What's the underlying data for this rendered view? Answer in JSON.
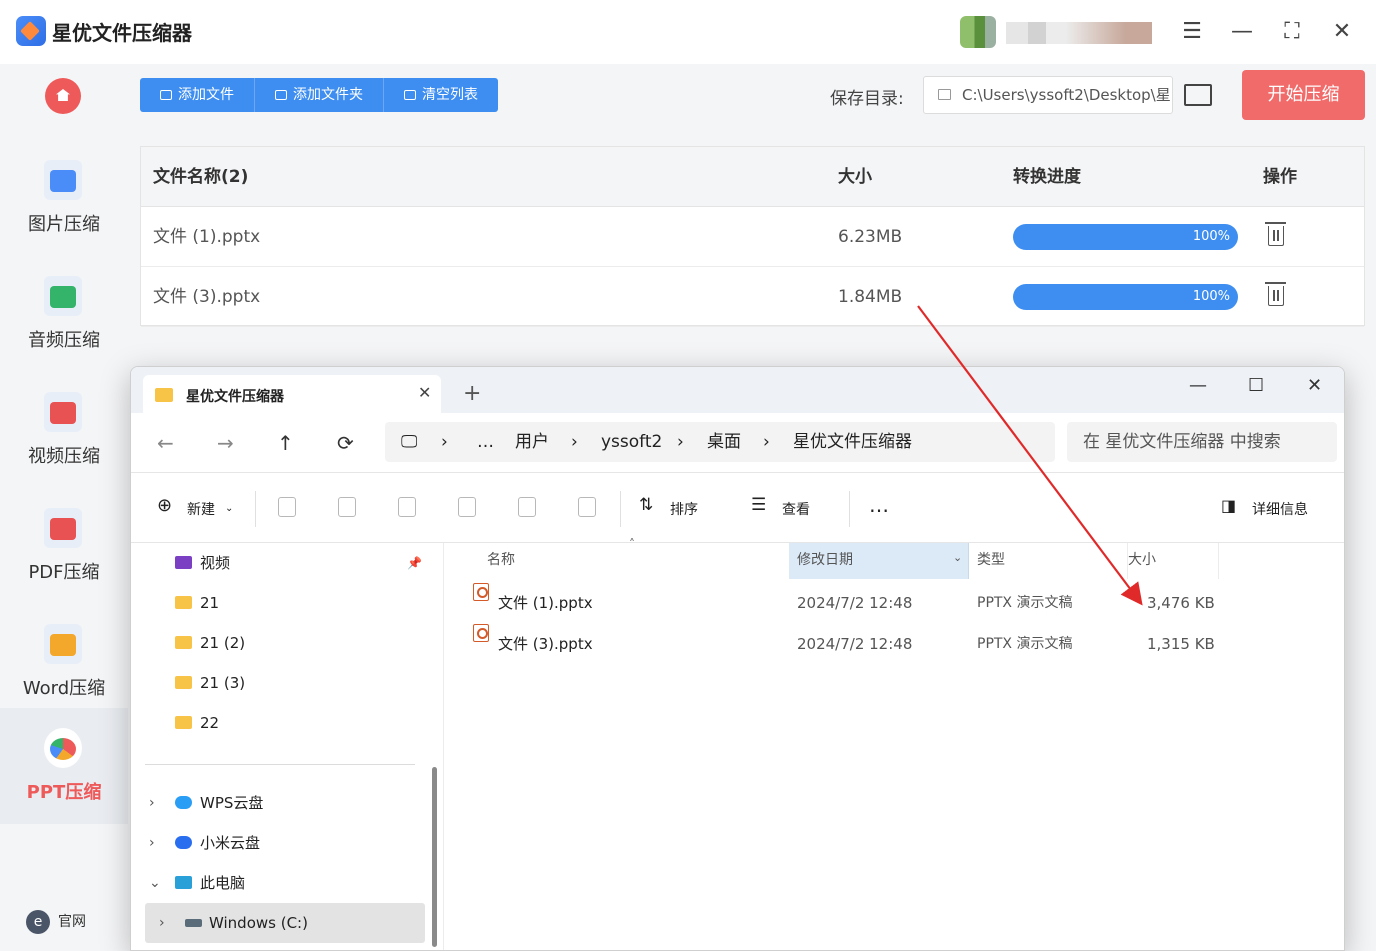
{
  "app": {
    "title": "星优文件压缩器",
    "official_label": "官网"
  },
  "sidebar": {
    "items": [
      {
        "label": "图片压缩",
        "color": "#4a8df8"
      },
      {
        "label": "音频压缩",
        "color": "#34b36b"
      },
      {
        "label": "视频压缩",
        "color": "#e85252"
      },
      {
        "label": "PDF压缩",
        "color": "#e85252"
      },
      {
        "label": "Word压缩",
        "color": "#f3a72b"
      },
      {
        "label": "PPT压缩",
        "color": "#ee5a5a"
      }
    ],
    "active": "PPT压缩"
  },
  "toolbar": {
    "add_file": "添加文件",
    "add_folder": "添加文件夹",
    "clear_list": "清空列表",
    "save_dir_label": "保存目录:",
    "save_dir_value": "C:\\Users\\yssoft2\\Desktop\\星",
    "start_button": "开始压缩"
  },
  "table": {
    "headers": {
      "name": "文件名称(2)",
      "size": "大小",
      "progress": "转换进度",
      "action": "操作"
    },
    "rows": [
      {
        "name": "文件 (1).pptx",
        "size": "6.23MB",
        "progress": "100%",
        "progress_value": 1.0
      },
      {
        "name": "文件 (3).pptx",
        "size": "1.84MB",
        "progress": "100%",
        "progress_value": 1.0
      }
    ]
  },
  "explorer": {
    "tab_title": "星优文件压缩器",
    "breadcrumb": [
      "…",
      "用户",
      "yssoft2",
      "桌面",
      "星优文件压缩器"
    ],
    "search_placeholder": "在 星优文件压缩器 中搜索",
    "commands": {
      "new": "新建",
      "sort": "排序",
      "view": "查看",
      "more": "…",
      "details": "详细信息"
    },
    "sidebar": [
      {
        "label": "视频",
        "type": "video"
      },
      {
        "label": "21",
        "type": "folder"
      },
      {
        "label": "21 (2)",
        "type": "folder"
      },
      {
        "label": "21 (3)",
        "type": "folder"
      },
      {
        "label": "22",
        "type": "folder"
      },
      {
        "label": "WPS云盘",
        "type": "cloud"
      },
      {
        "label": "小米云盘",
        "type": "cloud"
      },
      {
        "label": "此电脑",
        "type": "pc"
      },
      {
        "label": "Windows (C:)",
        "type": "drive"
      }
    ],
    "columns": {
      "name": "名称",
      "date": "修改日期",
      "type": "类型",
      "size": "大小"
    },
    "files": [
      {
        "name": "文件 (1).pptx",
        "date": "2024/7/2 12:48",
        "type": "PPTX 演示文稿",
        "size": "3,476 KB"
      },
      {
        "name": "文件 (3).pptx",
        "date": "2024/7/2 12:48",
        "type": "PPTX 演示文稿",
        "size": "1,315 KB"
      }
    ]
  },
  "colors": {
    "accent_blue": "#3d8ef0",
    "accent_red": "#f26b6b",
    "arrow": "#e02a2a"
  }
}
